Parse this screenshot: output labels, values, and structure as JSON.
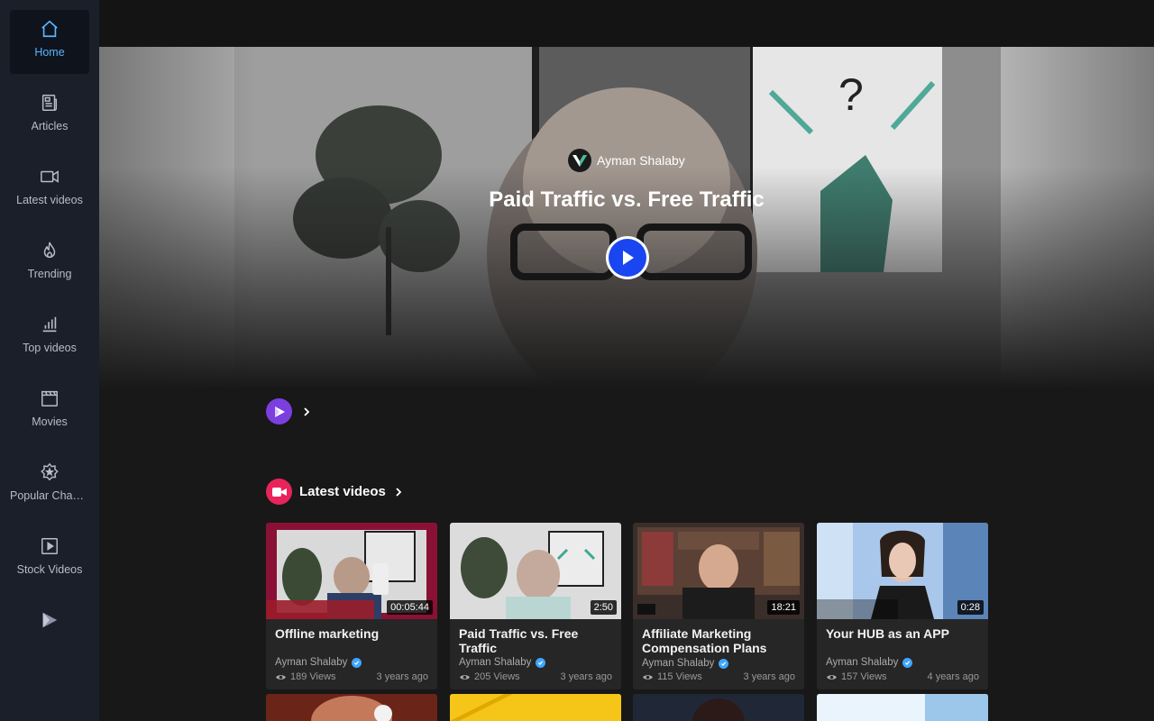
{
  "sidebar": {
    "items": [
      {
        "label": "Home",
        "icon": "home-icon",
        "active": true
      },
      {
        "label": "Articles",
        "icon": "newspaper-icon"
      },
      {
        "label": "Latest videos",
        "icon": "video-camera-icon"
      },
      {
        "label": "Trending",
        "icon": "flame-icon"
      },
      {
        "label": "Top videos",
        "icon": "bar-chart-icon"
      },
      {
        "label": "Movies",
        "icon": "clapperboard-icon"
      },
      {
        "label": "Popular Channels",
        "icon": "star-badge-icon"
      },
      {
        "label": "Stock Videos",
        "icon": "play-square-icon"
      },
      {
        "label": "",
        "icon": "brand-play-icon"
      }
    ]
  },
  "hero": {
    "channel": "Ayman Shalaby",
    "title": "Paid Traffic vs. Free Traffic"
  },
  "section": {
    "title": "Latest videos"
  },
  "videos": [
    {
      "title": "Offline marketing",
      "channel": "Ayman Shalaby",
      "views": "189 Views",
      "age": "3 years ago",
      "duration": "00:05:44"
    },
    {
      "title": "Paid Traffic vs. Free Traffic",
      "channel": "Ayman Shalaby",
      "views": "205 Views",
      "age": "3 years ago",
      "duration": "2:50"
    },
    {
      "title": "Affiliate Marketing Compensation Plans",
      "channel": "Ayman Shalaby",
      "views": "115 Views",
      "age": "3 years ago",
      "duration": "18:21"
    },
    {
      "title": "Your HUB as an APP",
      "channel": "Ayman Shalaby",
      "views": "157 Views",
      "age": "4 years ago",
      "duration": "0:28"
    }
  ],
  "colors": {
    "accent": "#5ab4ff",
    "play_button": "#1946f0",
    "section_icon": "#e8245a",
    "brand_logo": "#7b3fe0",
    "verified": "#3ea6ff"
  }
}
